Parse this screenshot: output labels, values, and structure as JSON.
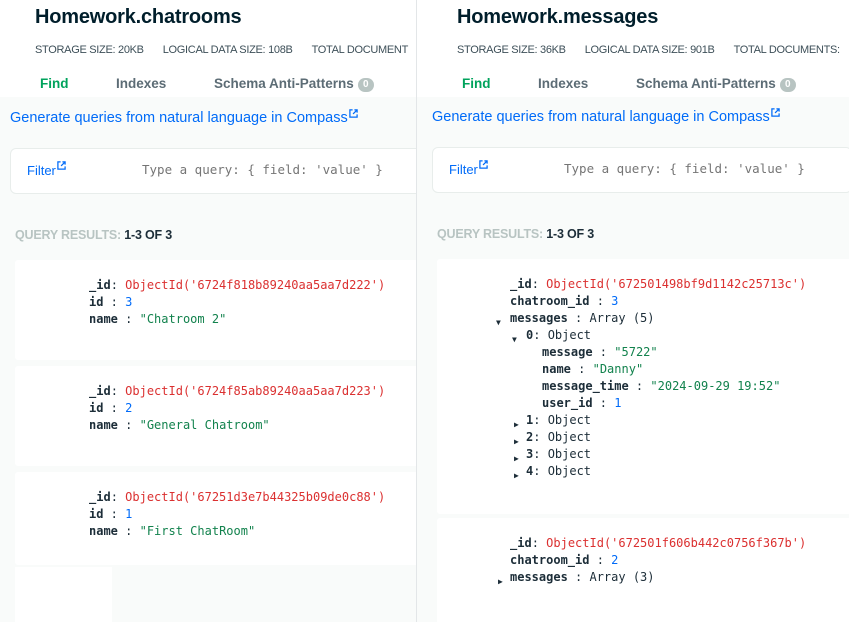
{
  "left": {
    "title": "Homework.chatrooms",
    "stats": {
      "storage": "STORAGE SIZE: 20KB",
      "logical": "LOGICAL DATA SIZE: 108B",
      "total": "TOTAL DOCUMENT"
    },
    "tabs": {
      "find": "Find",
      "indexes": "Indexes",
      "schema": "Schema Anti-Patterns",
      "schema_count": "0"
    },
    "gen_link": "Generate queries from natural language in Compass",
    "filter": {
      "label": "Filter",
      "placeholder": "Type a query: { field: 'value' }"
    },
    "results": {
      "label": "QUERY RESULTS:",
      "count": "1-3 OF 3"
    },
    "docs": [
      {
        "id_label": "_id",
        "id_value": "ObjectId('6724f818b89240aa5aa7d222')",
        "id2_label": "id",
        "id2_value": "3",
        "name_label": "name",
        "name_value": "\"Chatroom 2\""
      },
      {
        "id_label": "_id",
        "id_value": "ObjectId('6724f85ab89240aa5aa7d223')",
        "id2_label": "id",
        "id2_value": "2",
        "name_label": "name",
        "name_value": "\"General Chatroom\""
      },
      {
        "id_label": "_id",
        "id_value": "ObjectId('67251d3e7b44325b09de0c88')",
        "id2_label": "id",
        "id2_value": "1",
        "name_label": "name",
        "name_value": "\"First ChatRoom\""
      }
    ]
  },
  "right": {
    "title": "Homework.messages",
    "stats": {
      "storage": "STORAGE SIZE: 36KB",
      "logical": "LOGICAL DATA SIZE: 901B",
      "total": "TOTAL DOCUMENTS:"
    },
    "tabs": {
      "find": "Find",
      "indexes": "Indexes",
      "schema": "Schema Anti-Patterns",
      "schema_count": "0"
    },
    "gen_link": "Generate queries from natural language in Compass",
    "filter": {
      "label": "Filter",
      "placeholder": "Type a query: { field: 'value' }"
    },
    "results": {
      "label": "QUERY RESULTS:",
      "count": "1-3 OF 3"
    },
    "doc1": {
      "id_label": "_id",
      "id_value": "ObjectId('672501498bf9d1142c25713c')",
      "chatroom_label": "chatroom_id",
      "chatroom_value": "3",
      "messages_label": "messages",
      "messages_type": "Array (5)",
      "item0_label": "0",
      "item0_type": "Object",
      "message_label": "message",
      "message_value": "\"5722\"",
      "name_label": "name",
      "name_value": "\"Danny\"",
      "time_label": "message_time",
      "time_value": "\"2024-09-29 19:52\"",
      "user_label": "user_id",
      "user_value": "1",
      "collapsed": [
        {
          "label": "1",
          "type": "Object"
        },
        {
          "label": "2",
          "type": "Object"
        },
        {
          "label": "3",
          "type": "Object"
        },
        {
          "label": "4",
          "type": "Object"
        }
      ]
    },
    "doc2": {
      "id_label": "_id",
      "id_value": "ObjectId('672501f606b442c0756f367b')",
      "chatroom_label": "chatroom_id",
      "chatroom_value": "2",
      "messages_label": "messages",
      "messages_type": "Array (3)"
    }
  },
  "colors": {
    "accent_green": "#00a35c",
    "link_blue": "#016bf8",
    "objectid_red": "#db3030",
    "string_green": "#12824d",
    "content_bg": "#f9fbfa"
  }
}
